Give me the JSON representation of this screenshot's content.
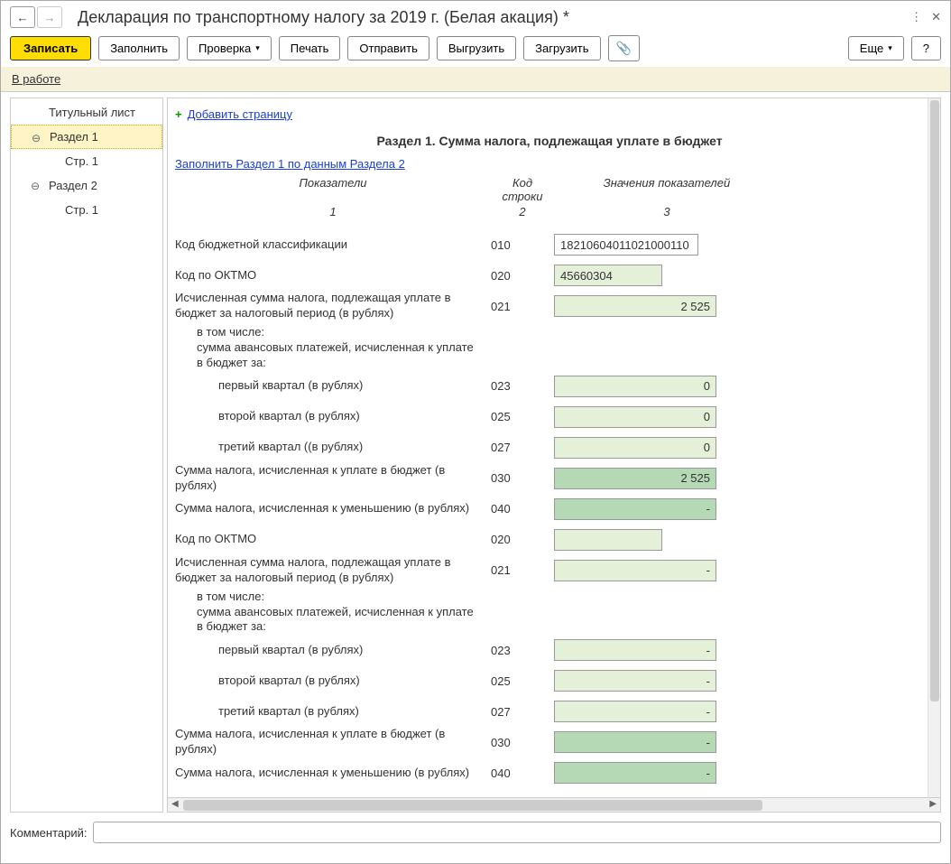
{
  "title": "Декларация по транспортному налогу за 2019 г. (Белая акация) *",
  "toolbar": {
    "write": "Записать",
    "fill": "Заполнить",
    "check": "Проверка",
    "print": "Печать",
    "send": "Отправить",
    "export": "Выгрузить",
    "import": "Загрузить",
    "more": "Еще",
    "help": "?"
  },
  "status": "В работе",
  "tree": {
    "title_page": "Титульный лист",
    "section1": "Раздел 1",
    "page1a": "Стр. 1",
    "section2": "Раздел 2",
    "page1b": "Стр. 1"
  },
  "content": {
    "add_page": "Добавить страницу",
    "section_title": "Раздел 1. Сумма налога, подлежащая уплате в бюджет",
    "fill_link": "Заполнить Раздел 1 по данным Раздела 2",
    "cols": {
      "label": "Показатели",
      "code": "Код строки",
      "value": "Значения показателей",
      "n1": "1",
      "n2": "2",
      "n3": "3"
    },
    "rows": [
      {
        "label": "Код бюджетной классификации",
        "code": "010",
        "value": "18210604011021000110",
        "box": "white",
        "align": "left",
        "wide": true
      },
      {
        "label": "Код по ОКТМО",
        "code": "020",
        "value": "45660304",
        "box": "plain",
        "align": "left",
        "short": true
      },
      {
        "label": "Исчисленная сумма налога, подлежащая уплате в бюджет за налоговый период (в рублях)",
        "code": "021",
        "value": "2 525",
        "box": "plain",
        "align": "right"
      },
      {
        "label": "в том числе:\nсумма авансовых платежей, исчисленная к уплате в бюджет за:",
        "indent": 1
      },
      {
        "label": "первый квартал (в рублях)",
        "code": "023",
        "value": "0",
        "box": "plain",
        "align": "right",
        "indent": 2
      },
      {
        "label": "второй квартал (в рублях)",
        "code": "025",
        "value": "0",
        "box": "plain",
        "align": "right",
        "indent": 2
      },
      {
        "label": "третий квартал ((в рублях)",
        "code": "027",
        "value": "0",
        "box": "plain",
        "align": "right",
        "indent": 2
      },
      {
        "label": "Сумма налога, исчисленная к уплате в бюджет (в рублях)",
        "code": "030",
        "value": "2 525",
        "box": "green",
        "align": "right"
      },
      {
        "label": "Сумма налога, исчисленная к уменьшению (в рублях)",
        "code": "040",
        "value": "-",
        "box": "green",
        "align": "right"
      },
      {
        "label": "Код по ОКТМО",
        "code": "020",
        "value": "",
        "box": "plain",
        "align": "left",
        "short": true
      },
      {
        "label": "Исчисленная сумма налога, подлежащая уплате в бюджет за налоговый период (в рублях)",
        "code": "021",
        "value": "-",
        "box": "plain",
        "align": "right"
      },
      {
        "label": "в том числе:\nсумма авансовых платежей, исчисленная к уплате в бюджет за:",
        "indent": 1
      },
      {
        "label": "первый квартал (в рублях)",
        "code": "023",
        "value": "-",
        "box": "plain",
        "align": "right",
        "indent": 2
      },
      {
        "label": "второй квартал (в рублях)",
        "code": "025",
        "value": "-",
        "box": "plain",
        "align": "right",
        "indent": 2
      },
      {
        "label": "третий квартал (в рублях)",
        "code": "027",
        "value": "-",
        "box": "plain",
        "align": "right",
        "indent": 2
      },
      {
        "label": "Сумма налога, исчисленная к уплате в бюджет (в рублях)",
        "code": "030",
        "value": "-",
        "box": "green",
        "align": "right"
      },
      {
        "label": "Сумма налога, исчисленная к уменьшению (в рублях)",
        "code": "040",
        "value": "-",
        "box": "green",
        "align": "right"
      }
    ]
  },
  "footer": {
    "comment_label": "Комментарий:"
  }
}
